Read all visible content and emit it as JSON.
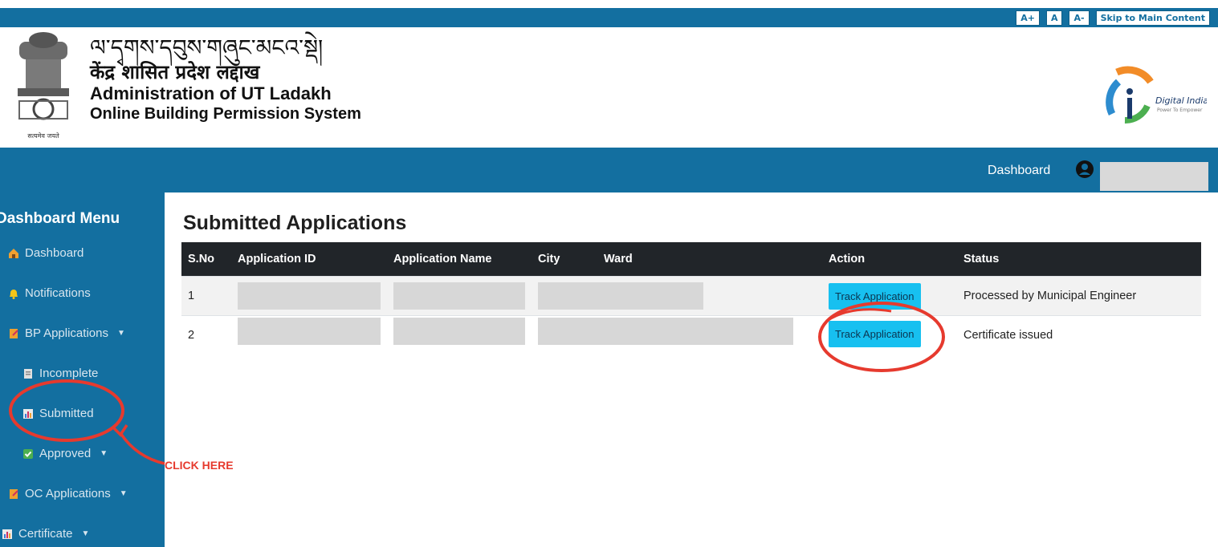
{
  "accessibility": {
    "font_increase": "A+",
    "font_normal": "A",
    "font_decrease": "A-",
    "skip_link": "Skip to Main Content"
  },
  "header": {
    "title_tibetan": "ལ་དྭགས་དབུས་གཞུང་མངའ་སྡེ།",
    "title_hindi": "केंद्र शासित प्रदेश लद्दाख",
    "title_english": "Administration of UT Ladakh",
    "subtitle": "Online Building Permission System",
    "emblem_caption": "सत्यमेव जयते",
    "digital_india_logo": "Digital India",
    "digital_india_tagline": "Power To Empower"
  },
  "navbar": {
    "dashboard_link": "Dashboard",
    "user_icon": "user-circle-icon"
  },
  "sidebar": {
    "title": "Dashboard Menu",
    "items": [
      {
        "label": "Dashboard",
        "icon": "house-icon"
      },
      {
        "label": "Notifications",
        "icon": "bell-icon"
      },
      {
        "label": "BP Applications",
        "icon": "document-icon"
      },
      {
        "label": "Incomplete",
        "icon": "clipboard-icon"
      },
      {
        "label": "Submitted",
        "icon": "bar-chart-icon"
      },
      {
        "label": "Approved",
        "icon": "checkbox-icon"
      },
      {
        "label": "OC Applications",
        "icon": "document-icon"
      },
      {
        "label": "Certificate",
        "icon": "bar-chart-icon"
      }
    ]
  },
  "main": {
    "title": "Submitted Applications",
    "columns": [
      "S.No",
      "Application ID",
      "Application Name",
      "City",
      "Ward",
      "Action",
      "Status"
    ],
    "rows": [
      {
        "sno": "1",
        "action": "Track Application",
        "status": "Processed by Municipal Engineer"
      },
      {
        "sno": "2",
        "action": "Track Application",
        "status": "Certificate issued"
      }
    ]
  },
  "annotation": {
    "label": "CLICK HERE",
    "color": "#e63a2e"
  },
  "colors": {
    "brand": "#136fa0",
    "table_header": "#212529",
    "button": "#17c0f0"
  }
}
